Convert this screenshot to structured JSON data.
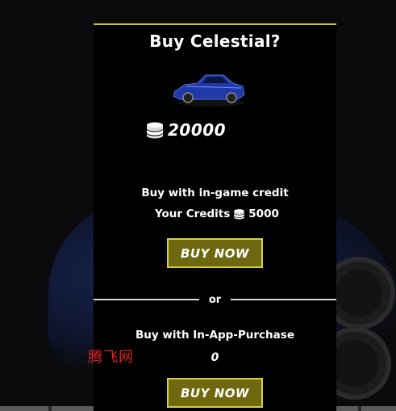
{
  "dialog": {
    "title": "Buy Celestial?",
    "price": "20000",
    "ingame_label": "Buy with in-game credit",
    "credits_label": "Your Credits",
    "credits_value": "5000",
    "buy_ingame_label": "BUY NOW",
    "separator": "or",
    "iap_label": "Buy with In-App-Purchase",
    "iap_price": "0",
    "buy_iap_label": "BUY NOW"
  },
  "watermark": "腾飞网",
  "icons": {
    "currency": "coin-stack-icon",
    "car": "car-image"
  },
  "colors": {
    "accent": "#c9c33a",
    "button_fill": "#6e6910",
    "car_blue": "#1f3aa8"
  }
}
